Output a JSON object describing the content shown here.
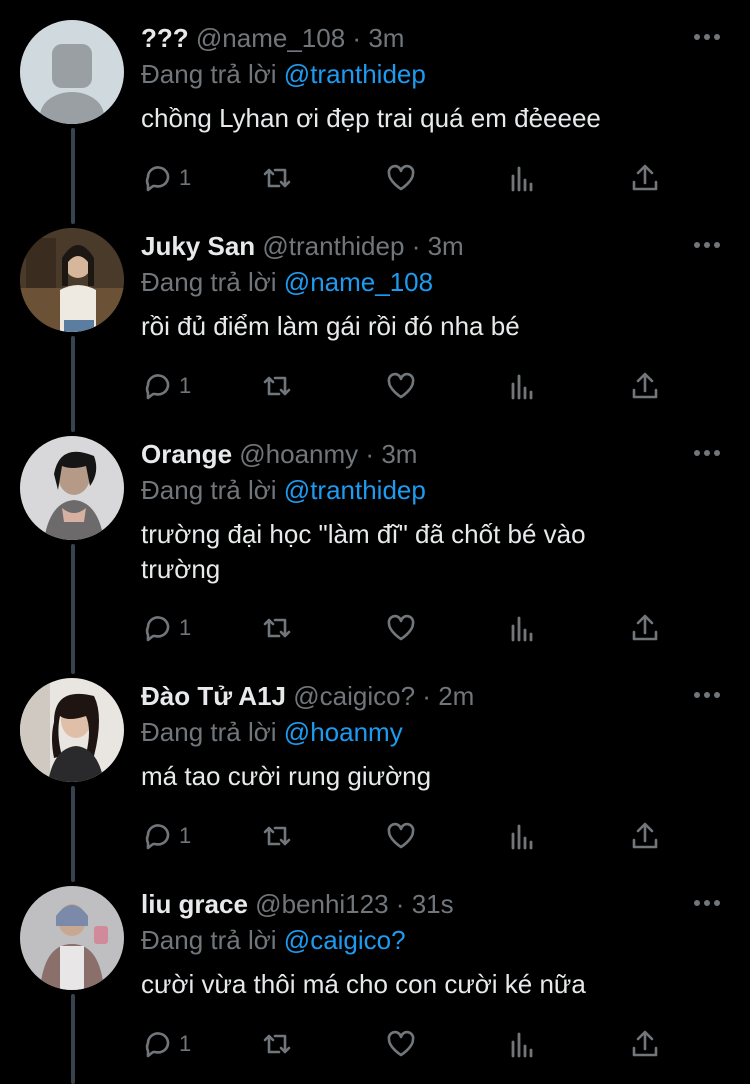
{
  "colors": {
    "background": "#000000",
    "text": "#e7e9ea",
    "muted": "#71767b",
    "accent": "#1d9bf0",
    "thread_line": "#38444d"
  },
  "replying_prefix": "Đang trả lời",
  "replies": [
    {
      "display_name": "???",
      "handle": "@name_108",
      "separator": "·",
      "time": "3m",
      "replying_to": "@tranthidep",
      "text": "chồng Lyhan ơi đẹp trai quá em đẻeeee",
      "reply_count": "1",
      "avatar": "default-avatar-icon"
    },
    {
      "display_name": "Juky San",
      "handle": "@tranthidep",
      "separator": "·",
      "time": "3m",
      "replying_to": "@name_108",
      "text": "rồi đủ điểm làm gái rồi đó nha bé",
      "reply_count": "1",
      "avatar": "user-photo"
    },
    {
      "display_name": "Orange",
      "handle": "@hoanmy",
      "separator": "·",
      "time": "3m",
      "replying_to": "@tranthidep",
      "text": "trường đại học \"làm đĩ\" đã chốt bé vào trường",
      "reply_count": "1",
      "avatar": "user-photo"
    },
    {
      "display_name": "Đào Tử A1J",
      "handle": "@caigico?",
      "separator": "·",
      "time": "2m",
      "replying_to": "@hoanmy",
      "text": "má tao cười rung giường",
      "reply_count": "1",
      "avatar": "user-photo"
    },
    {
      "display_name": "liu grace",
      "handle": "@benhi123",
      "separator": "·",
      "time": "31s",
      "replying_to": "@caigico?",
      "text": "cười vừa thôi má cho con cười ké nữa",
      "reply_count": "1",
      "avatar": "user-photo"
    }
  ],
  "icons": {
    "more": "more-horizontal-icon",
    "reply": "reply-bubble-icon",
    "retweet": "retweet-icon",
    "like": "heart-icon",
    "views": "analytics-icon",
    "share": "share-icon"
  }
}
